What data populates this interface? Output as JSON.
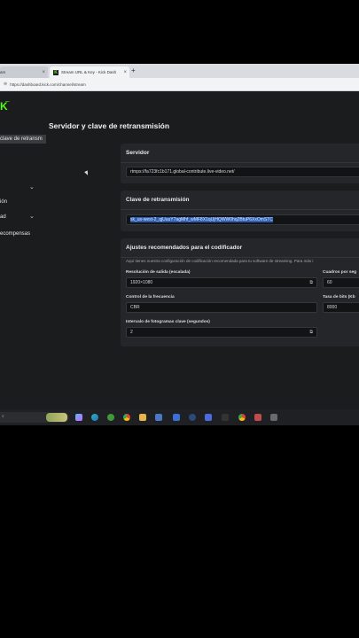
{
  "browser": {
    "tabs": [
      {
        "label": "am"
      },
      {
        "label": "Stream URL & Key - Kick Dash"
      }
    ],
    "url": "https://dashboard.kick.com/channel/stream"
  },
  "sidebar": {
    "items": [
      {
        "label": "clave de retransm"
      },
      {
        "label": "ión"
      },
      {
        "label": "ad"
      },
      {
        "label": "ecompensas"
      }
    ]
  },
  "page": {
    "title": "Servidor y clave de retransmisión",
    "server": {
      "heading": "Servidor",
      "value": "rtmps://fa723fc1b171.global-contribute.live-video.net/"
    },
    "key": {
      "heading": "Clave de retransmisión",
      "value": "sk_us-west-2_qjUuuY7agMhf_wMF8X1qUjHQWW0hq2BtuP6XxOmSTC"
    },
    "encoder": {
      "heading": "Ajustes recomendados para el codificador",
      "description": "Aquí tienes nuestra configuración de codificación recomendada para tu software de streaming. Para más i",
      "resolution_label": "Resolución de salida (escalada)",
      "resolution_value": "1920×1080",
      "fps_label": "Cuadros por seg",
      "fps_value": "60",
      "rate_control_label": "Control de la frecuencia",
      "rate_control_value": "CBR",
      "bitrate_label": "Tasa de bits (Kb",
      "bitrate_value": "8000",
      "keyframe_label": "Intervalo de fotogramas clave (segundos)",
      "keyframe_value": "2"
    }
  },
  "taskbar": {
    "icons": [
      "copilot-icon",
      "edge-icon",
      "xbox-icon",
      "chrome-icon",
      "files-icon",
      "store-icon",
      "phone-link-icon",
      "steam-icon",
      "app-icon",
      "kick-icon",
      "chrome2-icon",
      "recorder-icon",
      "game-icon"
    ]
  }
}
